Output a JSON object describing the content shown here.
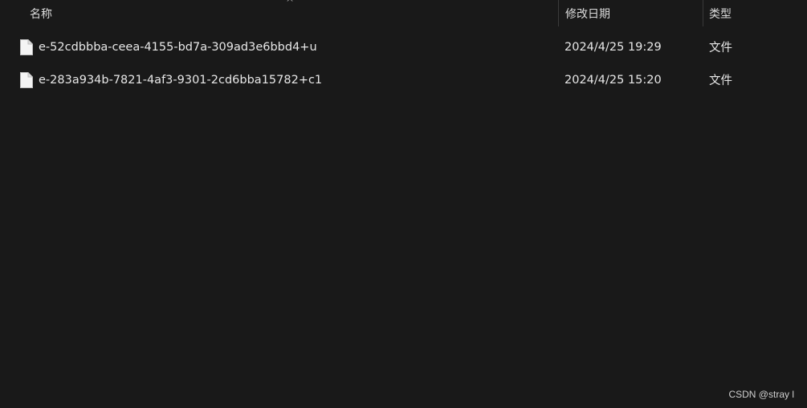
{
  "header": {
    "name_label": "名称",
    "date_label": "修改日期",
    "type_label": "类型",
    "sort_indicator": "^"
  },
  "files": [
    {
      "icon": "file-icon",
      "name": "e-52cdbbba-ceea-4155-bd7a-309ad3e6bbd4+u",
      "modified": "2024/4/25 19:29",
      "type": "文件"
    },
    {
      "icon": "file-icon",
      "name": "e-283a934b-7821-4af3-9301-2cd6bba15782+c1",
      "modified": "2024/4/25 15:20",
      "type": "文件"
    }
  ],
  "watermark": "CSDN @stray l",
  "colors": {
    "background": "#191919",
    "text": "#e8e8e8",
    "divider": "#3a3a3a"
  }
}
